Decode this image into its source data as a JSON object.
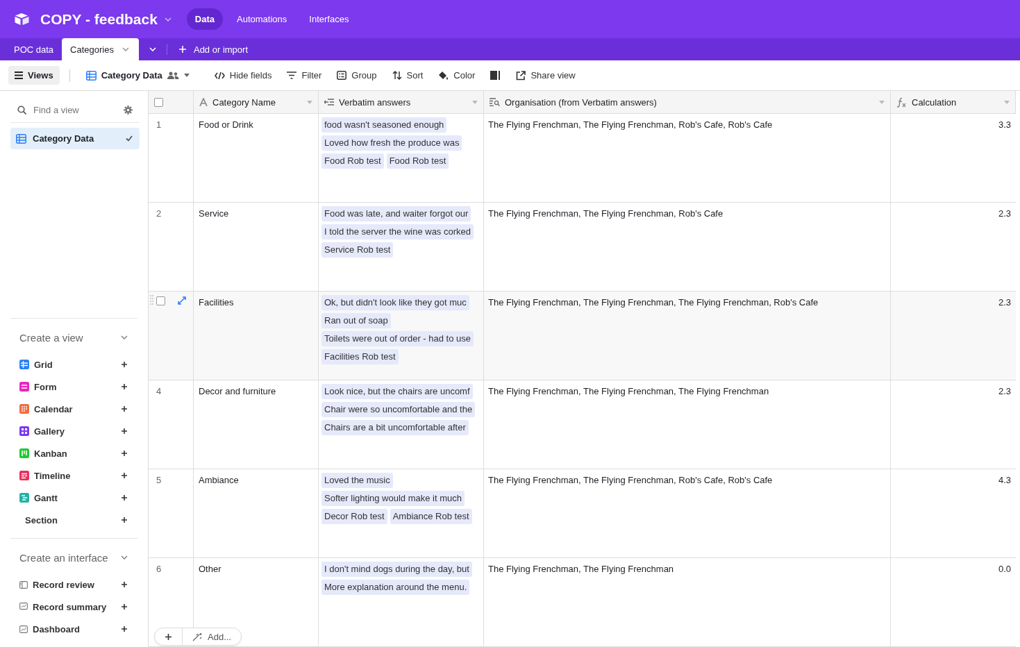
{
  "base": {
    "name": "COPY - feedback"
  },
  "nav": [
    {
      "label": "Data",
      "selected": true
    },
    {
      "label": "Automations",
      "selected": false
    },
    {
      "label": "Interfaces",
      "selected": false
    }
  ],
  "tables": [
    {
      "label": "POC data",
      "selected": false
    },
    {
      "label": "Categories",
      "selected": true
    }
  ],
  "add_import": "Add or import",
  "toolbar": {
    "views": "Views",
    "view_name": "Category Data",
    "buttons": [
      {
        "kind": "hide",
        "label": "Hide fields"
      },
      {
        "kind": "filter",
        "label": "Filter"
      },
      {
        "kind": "group",
        "label": "Group"
      },
      {
        "kind": "sort",
        "label": "Sort"
      },
      {
        "kind": "color",
        "label": "Color"
      },
      {
        "kind": "density"
      },
      {
        "kind": "share",
        "label": "Share view"
      }
    ]
  },
  "sidebar": {
    "search": {
      "placeholder": "Find a view"
    },
    "views": [
      {
        "label": "Category Data",
        "selected": true
      }
    ],
    "create_view": {
      "title": "Create a view",
      "items": [
        {
          "kind": "grid",
          "label": "Grid",
          "color": "#2d7ff9"
        },
        {
          "kind": "form",
          "label": "Form",
          "color": "#e929ba"
        },
        {
          "kind": "calendar",
          "label": "Calendar",
          "color": "#f26d3d"
        },
        {
          "kind": "gallery",
          "label": "Gallery",
          "color": "#7c39ed"
        },
        {
          "kind": "kanban",
          "label": "Kanban",
          "color": "#20c933"
        },
        {
          "kind": "timeline",
          "label": "Timeline",
          "color": "#e8305f"
        },
        {
          "kind": "gantt",
          "label": "Gantt",
          "color": "#25b3a6"
        },
        {
          "kind": "section",
          "label": "Section"
        }
      ]
    },
    "create_interface": {
      "title": "Create an interface",
      "items": [
        {
          "kind": "review",
          "label": "Record review"
        },
        {
          "kind": "summary",
          "label": "Record summary"
        },
        {
          "kind": "dashboard",
          "label": "Dashboard"
        }
      ]
    }
  },
  "grid": {
    "select_all": {
      "checked": false
    },
    "columns": [
      {
        "kind": "text",
        "label": "Category Name"
      },
      {
        "kind": "links",
        "label": "Verbatim answers"
      },
      {
        "kind": "lookup",
        "label": "Organisation (from Verbatim answers)"
      },
      {
        "kind": "formula",
        "label": "Calculation"
      }
    ],
    "rows": [
      {
        "number": "1",
        "hovered": false,
        "name": "Food or Drink",
        "answers": [
          "food wasn't seasoned enough",
          "Loved how fresh the produce was",
          "Food Rob test",
          "Food Rob test"
        ],
        "organisations": "The Flying Frenchman, The Flying Frenchman, Rob's Cafe, Rob's Cafe",
        "calculation": "3.3"
      },
      {
        "number": "2",
        "hovered": false,
        "name": "Service",
        "answers": [
          "Food was late, and waiter forgot our",
          "I told the server the wine was corked",
          "Service Rob test"
        ],
        "organisations": "The Flying Frenchman, The Flying Frenchman, Rob's Cafe",
        "calculation": "2.3"
      },
      {
        "hovered": true,
        "checked": false,
        "name": "Facilities",
        "answers": [
          "Ok, but didn't look like they got muc",
          "Ran out of soap",
          "Toilets were out of order - had to use",
          "Facilities Rob test"
        ],
        "organisations": "The Flying Frenchman, The Flying Frenchman, The Flying Frenchman, Rob's Cafe",
        "calculation": "2.3"
      },
      {
        "number": "4",
        "hovered": false,
        "name": "Decor and furniture",
        "answers": [
          "Look nice, but the chairs are uncomf",
          "Chair were so uncomfortable and the",
          "Chairs are a bit uncomfortable after"
        ],
        "organisations": "The Flying Frenchman, The Flying Frenchman, The Flying Frenchman",
        "calculation": "2.3"
      },
      {
        "number": "5",
        "hovered": false,
        "name": "Ambiance",
        "answers": [
          "Loved the music",
          "Softer lighting would make it much",
          "Decor Rob test",
          "Ambiance Rob test"
        ],
        "organisations": "The Flying Frenchman, The Flying Frenchman, Rob's Cafe, Rob's Cafe",
        "calculation": "4.3"
      },
      {
        "number": "6",
        "hovered": false,
        "name": "Other",
        "answers": [
          "I don't mind dogs during the day, but",
          "More explanation around the menu."
        ],
        "organisations": "The Flying Frenchman, The Flying Frenchman",
        "calculation": "0.0"
      }
    ],
    "add_bar": {
      "label": "Add..."
    }
  }
}
